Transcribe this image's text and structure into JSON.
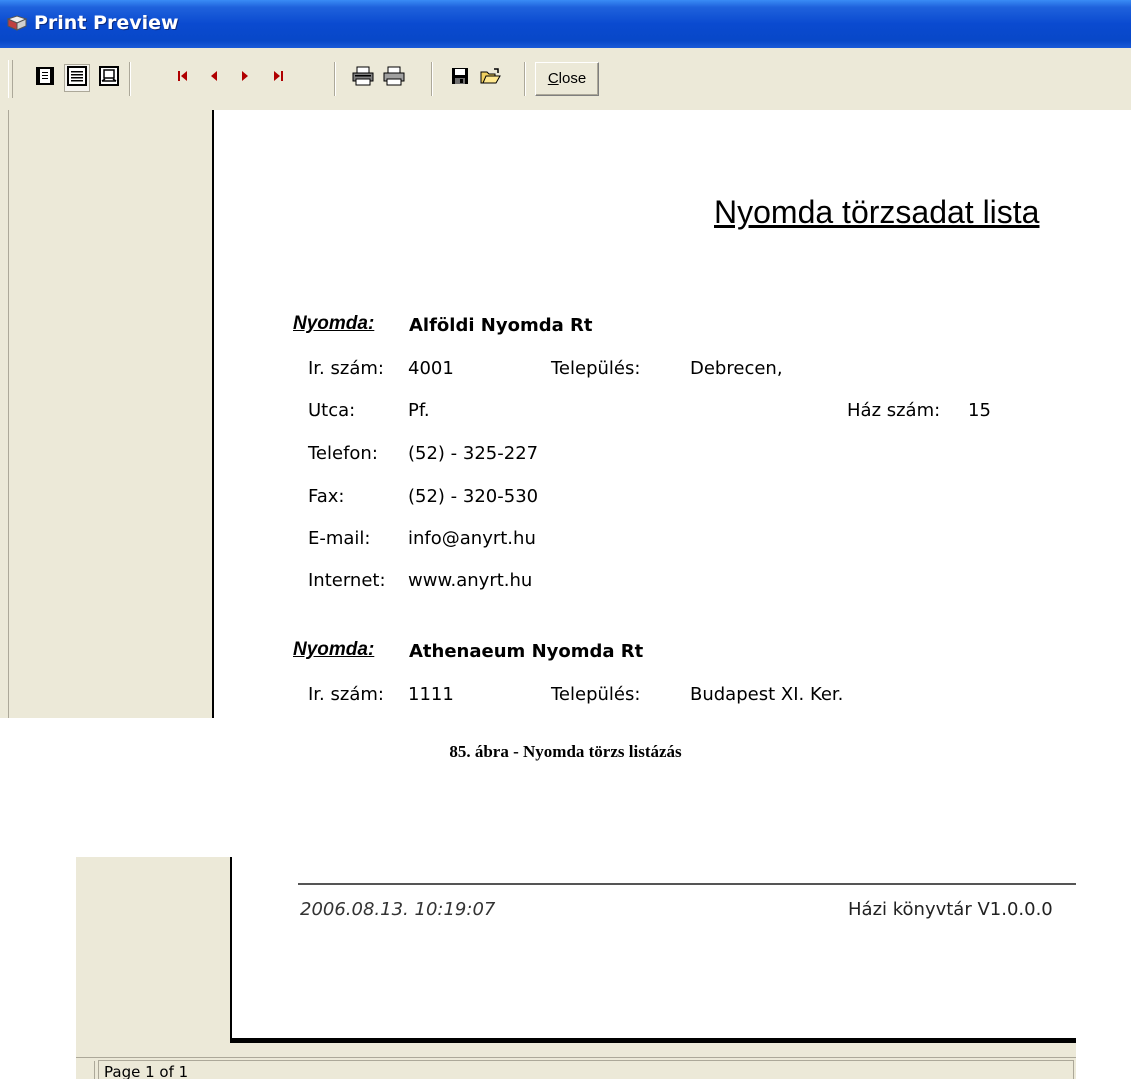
{
  "window": {
    "title": "Print Preview"
  },
  "toolbar": {
    "close_label_ul": "C",
    "close_label_rest": "lose",
    "icons": [
      "one-page-icon",
      "page-width-icon",
      "zoom-icon",
      "first-page-icon",
      "prev-page-icon",
      "next-page-icon",
      "last-page-icon",
      "print-setup-icon",
      "print-icon",
      "save-icon",
      "open-icon"
    ]
  },
  "document": {
    "title": "Nyomda törzsadat lista",
    "records": [
      {
        "label": "Nyomda:",
        "name": "Alföldi Nyomda Rt",
        "fields": {
          "irszam_label": "Ir. szám:",
          "irszam": "4001",
          "telepules_label": "Település:",
          "telepules": "Debrecen,",
          "utca_label": "Utca:",
          "utca": "Pf.",
          "hazszam_label": "Ház szám:",
          "hazszam": "15",
          "telefon_label": "Telefon:",
          "telefon": "(52) - 325-227",
          "fax_label": "Fax:",
          "fax": "(52) - 320-530",
          "email_label": "E-mail:",
          "email": "info@anyrt.hu",
          "internet_label": "Internet:",
          "internet": "www.anyrt.hu"
        }
      },
      {
        "label": "Nyomda:",
        "name": "Athenaeum Nyomda Rt",
        "fields": {
          "irszam_label": "Ir. szám:",
          "irszam": "1111",
          "telepules_label": "Település:",
          "telepules": "Budapest XI. Ker."
        }
      }
    ]
  },
  "caption": "85. ábra - Nyomda törzs listázás",
  "footer": {
    "datetime": "2006.08.13. 10:19:07",
    "app": "Házi könyvtár V1.0.0.0"
  },
  "status": {
    "page": "Page 1 of 1"
  },
  "colors": {
    "titlebar": "#0a4ad0",
    "chrome": "#ece9d8",
    "navarrow": "#b00000"
  }
}
